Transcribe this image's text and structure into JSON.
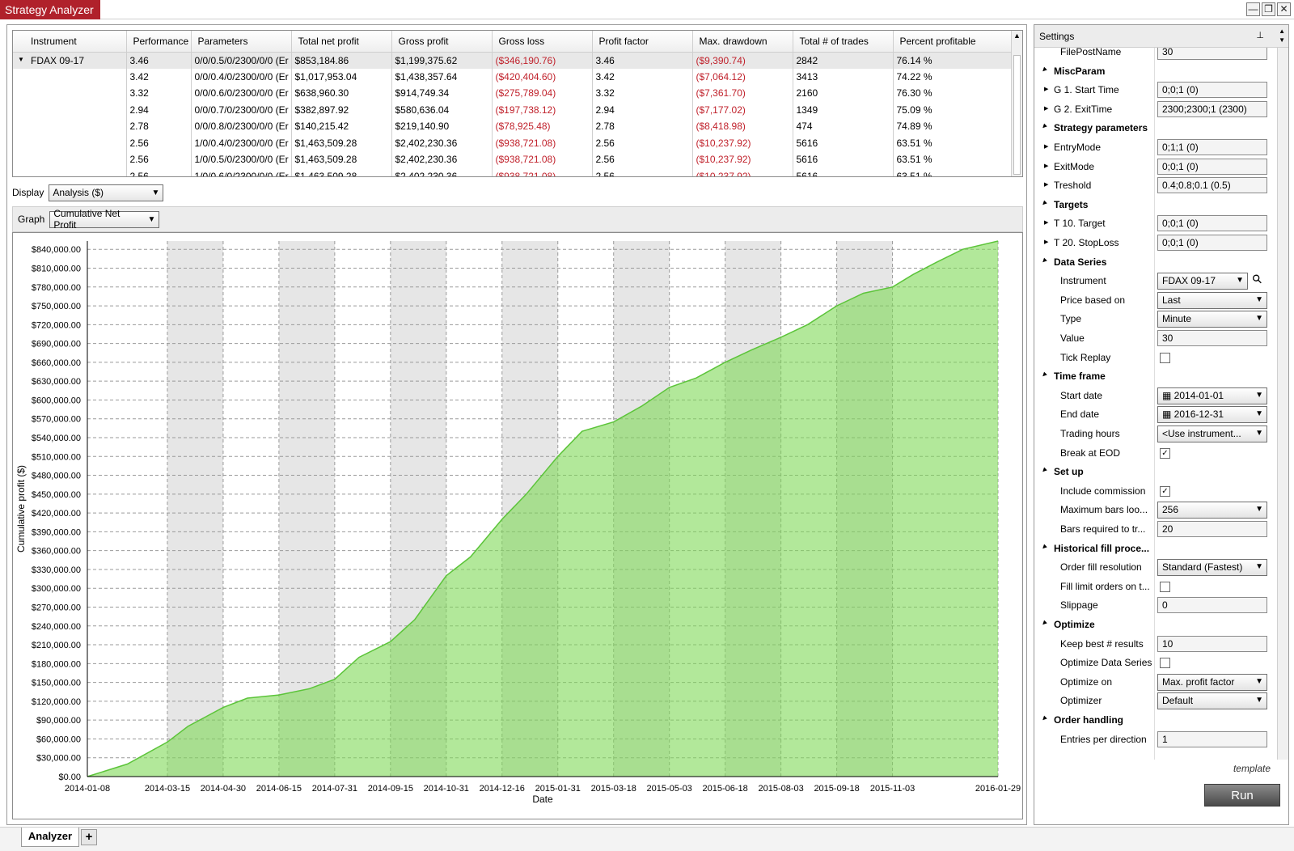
{
  "window": {
    "title": "Strategy Analyzer",
    "buttons": [
      "—",
      "❐",
      "✕"
    ]
  },
  "results": {
    "columns": [
      "Instrument",
      "Performance",
      "Parameters",
      "Total net profit",
      "Gross profit",
      "Gross loss",
      "Profit factor",
      "Max. drawdown",
      "Total # of trades",
      "Percent profitable"
    ],
    "rows": [
      {
        "instrument": "FDAX 09-17",
        "performance": "3.46",
        "parameters": "0/0/0.5/0/2300/0/0 (Er",
        "net": "$853,184.86",
        "gross_profit": "$1,199,375.62",
        "gross_loss": "($346,190.76)",
        "pf": "3.46",
        "dd": "($9,390.74)",
        "trades": "2842",
        "pct": "76.14 %"
      },
      {
        "instrument": "",
        "performance": "3.42",
        "parameters": "0/0/0.4/0/2300/0/0 (Er",
        "net": "$1,017,953.04",
        "gross_profit": "$1,438,357.64",
        "gross_loss": "($420,404.60)",
        "pf": "3.42",
        "dd": "($7,064.12)",
        "trades": "3413",
        "pct": "74.22 %"
      },
      {
        "instrument": "",
        "performance": "3.32",
        "parameters": "0/0/0.6/0/2300/0/0 (Er",
        "net": "$638,960.30",
        "gross_profit": "$914,749.34",
        "gross_loss": "($275,789.04)",
        "pf": "3.32",
        "dd": "($7,361.70)",
        "trades": "2160",
        "pct": "76.30 %"
      },
      {
        "instrument": "",
        "performance": "2.94",
        "parameters": "0/0/0.7/0/2300/0/0 (Er",
        "net": "$382,897.92",
        "gross_profit": "$580,636.04",
        "gross_loss": "($197,738.12)",
        "pf": "2.94",
        "dd": "($7,177.02)",
        "trades": "1349",
        "pct": "75.09 %"
      },
      {
        "instrument": "",
        "performance": "2.78",
        "parameters": "0/0/0.8/0/2300/0/0 (Er",
        "net": "$140,215.42",
        "gross_profit": "$219,140.90",
        "gross_loss": "($78,925.48)",
        "pf": "2.78",
        "dd": "($8,418.98)",
        "trades": "474",
        "pct": "74.89 %"
      },
      {
        "instrument": "",
        "performance": "2.56",
        "parameters": "1/0/0.4/0/2300/0/0 (Er",
        "net": "$1,463,509.28",
        "gross_profit": "$2,402,230.36",
        "gross_loss": "($938,721.08)",
        "pf": "2.56",
        "dd": "($10,237.92)",
        "trades": "5616",
        "pct": "63.51 %"
      },
      {
        "instrument": "",
        "performance": "2.56",
        "parameters": "1/0/0.5/0/2300/0/0 (Er",
        "net": "$1,463,509.28",
        "gross_profit": "$2,402,230.36",
        "gross_loss": "($938,721.08)",
        "pf": "2.56",
        "dd": "($10,237.92)",
        "trades": "5616",
        "pct": "63.51 %"
      },
      {
        "instrument": "",
        "performance": "2.56",
        "parameters": "1/0/0.6/0/2300/0/0 (Er",
        "net": "$1,463,509.28",
        "gross_profit": "$2,402,230.36",
        "gross_loss": "($938,721.08)",
        "pf": "2.56",
        "dd": "($10,237.92)",
        "trades": "5616",
        "pct": "63.51 %"
      }
    ]
  },
  "display": {
    "label": "Display",
    "value": "Analysis ($)"
  },
  "graph": {
    "label": "Graph",
    "value": "Cumulative Net Profit"
  },
  "chart_data": {
    "type": "area",
    "xlabel": "Date",
    "ylabel": "Cumulative profit ($)",
    "ylim": [
      0,
      853184.86
    ],
    "color": "#7ed957",
    "yticks": [
      "$0.00",
      "$30,000.00",
      "$60,000.00",
      "$90,000.00",
      "$120,000.00",
      "$150,000.00",
      "$180,000.00",
      "$210,000.00",
      "$240,000.00",
      "$270,000.00",
      "$300,000.00",
      "$330,000.00",
      "$360,000.00",
      "$390,000.00",
      "$420,000.00",
      "$450,000.00",
      "$480,000.00",
      "$510,000.00",
      "$540,000.00",
      "$570,000.00",
      "$600,000.00",
      "$630,000.00",
      "$660,000.00",
      "$690,000.00",
      "$720,000.00",
      "$750,000.00",
      "$780,000.00",
      "$810,000.00",
      "$840,000.00"
    ],
    "xticks": [
      "2014-01-08",
      "2014-03-15",
      "2014-04-30",
      "2014-06-15",
      "2014-07-31",
      "2014-09-15",
      "2014-10-31",
      "2014-12-16",
      "2015-01-31",
      "2015-03-18",
      "2015-05-03",
      "2015-06-18",
      "2015-08-03",
      "2015-09-18",
      "2015-11-03",
      "2016-01-29"
    ],
    "x": [
      "2014-01-08",
      "2014-02-10",
      "2014-03-15",
      "2014-04-01",
      "2014-04-30",
      "2014-05-20",
      "2014-06-15",
      "2014-07-10",
      "2014-07-31",
      "2014-08-20",
      "2014-09-15",
      "2014-10-05",
      "2014-10-31",
      "2014-11-20",
      "2014-12-16",
      "2015-01-05",
      "2015-01-31",
      "2015-02-20",
      "2015-03-18",
      "2015-04-10",
      "2015-05-03",
      "2015-05-25",
      "2015-06-18",
      "2015-07-10",
      "2015-08-03",
      "2015-08-25",
      "2015-09-18",
      "2015-10-10",
      "2015-11-03",
      "2015-11-20",
      "2015-12-10",
      "2015-12-31",
      "2016-01-29"
    ],
    "values": [
      0,
      20000,
      55000,
      80000,
      110000,
      125000,
      130000,
      140000,
      155000,
      190000,
      215000,
      250000,
      320000,
      350000,
      410000,
      450000,
      510000,
      550000,
      565000,
      590000,
      620000,
      635000,
      660000,
      680000,
      700000,
      720000,
      750000,
      770000,
      780000,
      800000,
      820000,
      840000,
      853184.86
    ]
  },
  "settings": {
    "title": "Settings",
    "pin": "📌",
    "partial_top": {
      "label": "FilePostName",
      "value": "30"
    },
    "sections": [
      {
        "name": "MiscParam",
        "items": [
          {
            "label": "G 1. Start Time",
            "value": "0;0;1 (0)",
            "kind": "field",
            "expand": true
          },
          {
            "label": "G 2. ExitTime",
            "value": "2300;2300;1 (2300)",
            "kind": "field",
            "expand": true
          }
        ]
      },
      {
        "name": "Strategy parameters",
        "items": [
          {
            "label": "EntryMode",
            "value": "0;1;1 (0)",
            "kind": "field",
            "expand": true
          },
          {
            "label": "ExitMode",
            "value": "0;0;1 (0)",
            "kind": "field",
            "expand": true
          },
          {
            "label": "Treshold",
            "value": "0.4;0.8;0.1 (0.5)",
            "kind": "field",
            "expand": true
          }
        ]
      },
      {
        "name": "Targets",
        "items": [
          {
            "label": "T 10. Target",
            "value": "0;0;1 (0)",
            "kind": "field",
            "expand": true
          },
          {
            "label": "T 20. StopLoss",
            "value": "0;0;1 (0)",
            "kind": "field",
            "expand": true
          }
        ]
      },
      {
        "name": "Data Series",
        "items": [
          {
            "label": "Instrument",
            "value": "FDAX 09-17",
            "kind": "dd"
          },
          {
            "label": "Price based on",
            "value": "Last",
            "kind": "dd"
          },
          {
            "label": "Type",
            "value": "Minute",
            "kind": "dd"
          },
          {
            "label": "Value",
            "value": "30",
            "kind": "field"
          },
          {
            "label": "Tick Replay",
            "value": "",
            "kind": "cb"
          }
        ]
      },
      {
        "name": "Time frame",
        "items": [
          {
            "label": "Start date",
            "value": "▦ 2014-01-01",
            "kind": "dd"
          },
          {
            "label": "End date",
            "value": "▦ 2016-12-31",
            "kind": "dd"
          },
          {
            "label": "Trading hours",
            "value": "<Use instrument...",
            "kind": "dd"
          },
          {
            "label": "Break at EOD",
            "value": "✓",
            "kind": "cb"
          }
        ]
      },
      {
        "name": "Set up",
        "items": [
          {
            "label": "Include commission",
            "value": "✓",
            "kind": "cb"
          },
          {
            "label": "Maximum bars loo...",
            "value": "256",
            "kind": "dd"
          },
          {
            "label": "Bars required to tr...",
            "value": "20",
            "kind": "field"
          }
        ]
      },
      {
        "name": "Historical fill proce...",
        "items": [
          {
            "label": "Order fill resolution",
            "value": "Standard (Fastest)",
            "kind": "dd"
          },
          {
            "label": "Fill limit orders on t...",
            "value": "",
            "kind": "cb"
          },
          {
            "label": "Slippage",
            "value": "0",
            "kind": "field"
          }
        ]
      },
      {
        "name": "Optimize",
        "items": [
          {
            "label": "Keep best # results",
            "value": "10",
            "kind": "field"
          },
          {
            "label": "Optimize Data Series",
            "value": "",
            "kind": "cb"
          },
          {
            "label": "Optimize on",
            "value": "Max. profit factor",
            "kind": "dd"
          },
          {
            "label": "Optimizer",
            "value": "Default",
            "kind": "dd"
          }
        ]
      },
      {
        "name": "Order handling",
        "items": [
          {
            "label": "Entries per direction",
            "value": "1",
            "kind": "field"
          }
        ]
      }
    ],
    "template_label": "template",
    "run_label": "Run"
  },
  "tabs": {
    "active": "Analyzer",
    "add": "+"
  }
}
